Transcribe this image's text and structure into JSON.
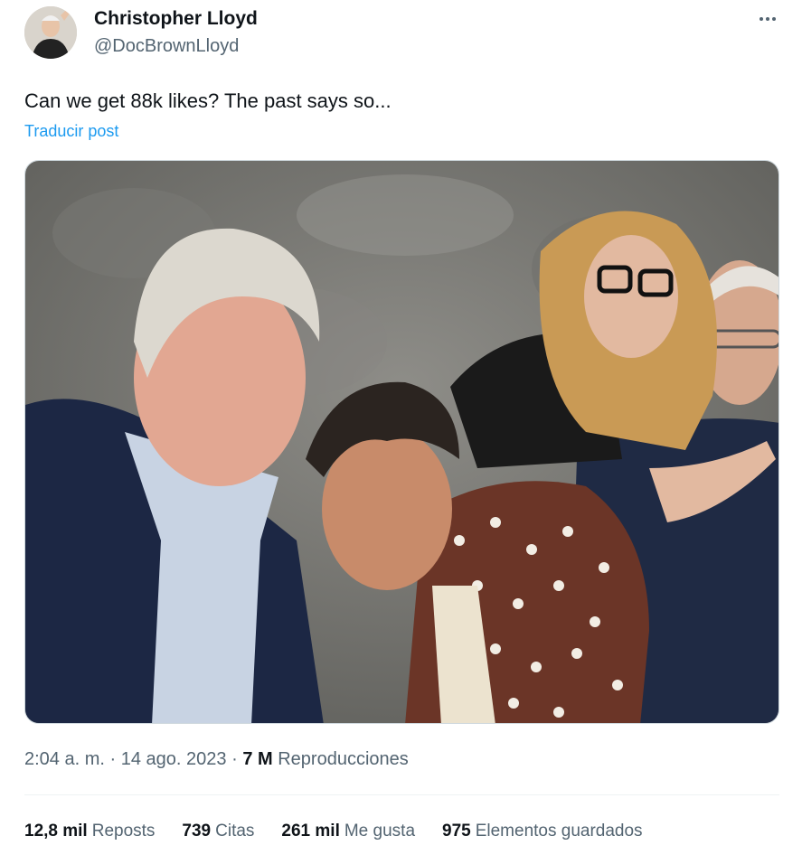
{
  "author": {
    "name": "Christopher Lloyd",
    "handle": "@DocBrownLloyd"
  },
  "post": {
    "text": "Can we get 88k likes? The past says so...",
    "translate_label": "Traducir post"
  },
  "meta": {
    "time": "2:04 a. m.",
    "separator": "·",
    "date": "14 ago. 2023",
    "views_count": "7 M",
    "views_label": "Reproducciones"
  },
  "stats": {
    "reposts_count": "12,8 mil",
    "reposts_label": "Reposts",
    "quotes_count": "739",
    "quotes_label": "Citas",
    "likes_count": "261 mil",
    "likes_label": "Me gusta",
    "bookmarks_count": "975",
    "bookmarks_label": "Elementos guardados"
  },
  "icons": {
    "more": "more-options-icon"
  },
  "colors": {
    "link": "#1d9bf0",
    "secondary_text": "#536471",
    "primary_text": "#0f1419"
  }
}
